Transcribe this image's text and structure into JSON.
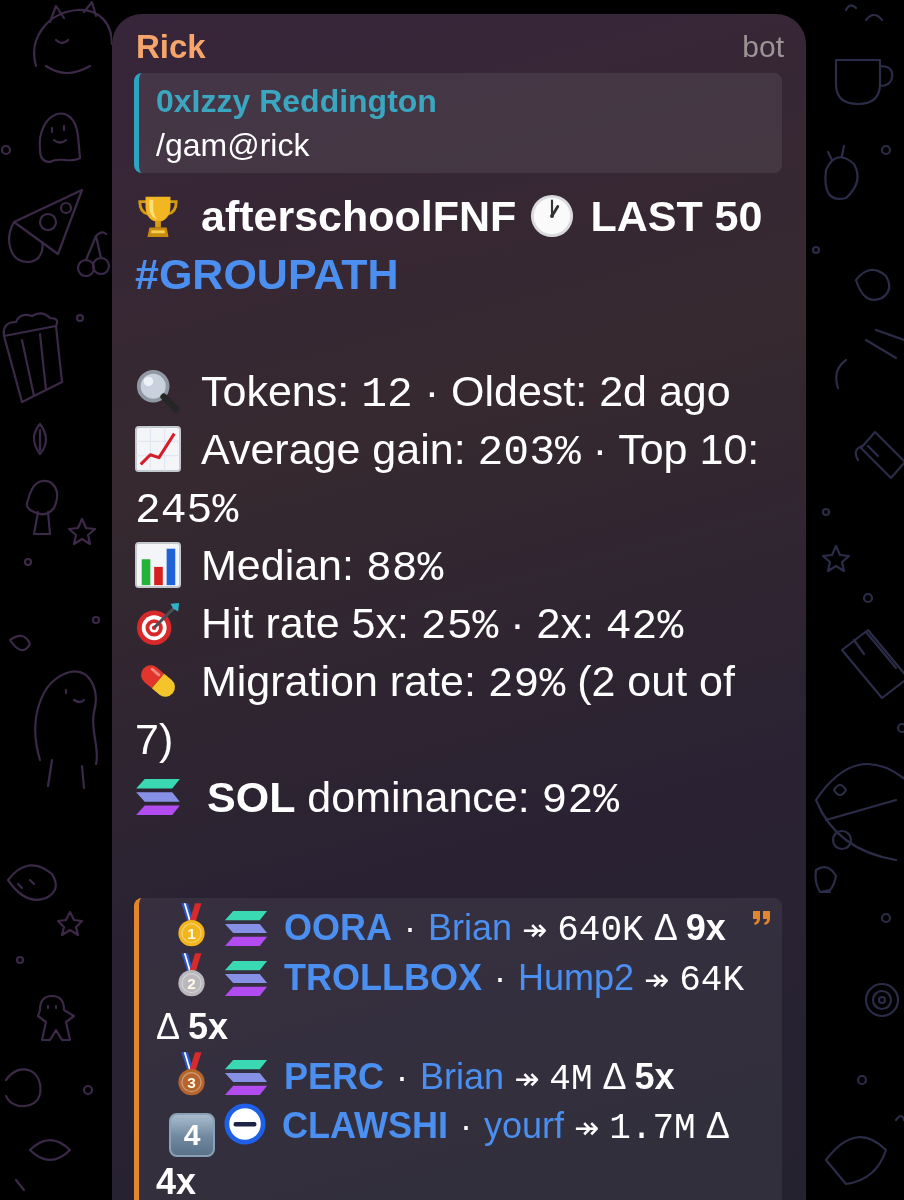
{
  "header": {
    "sender": "Rick",
    "badge": "bot"
  },
  "reply": {
    "author": "0xIzzy Reddington",
    "text": "/gam@rick"
  },
  "title": {
    "group": "afterschoolFNF",
    "period": "LAST 50",
    "hashtag": "#GROUPATH"
  },
  "stats": [
    {
      "segments": [
        {
          "kind": "text",
          "text": "Tokens: "
        },
        {
          "kind": "code",
          "text": "12"
        },
        {
          "kind": "text",
          "text": " · Oldest: 2d ago"
        }
      ]
    },
    {
      "segments": [
        {
          "kind": "text",
          "text": "Average gain: "
        },
        {
          "kind": "code",
          "text": "203%"
        },
        {
          "kind": "text",
          "text": " · Top 10: "
        },
        {
          "kind": "code",
          "text": "245%"
        }
      ]
    },
    {
      "segments": [
        {
          "kind": "text",
          "text": "Median: "
        },
        {
          "kind": "code",
          "text": "88%"
        }
      ]
    },
    {
      "segments": [
        {
          "kind": "text",
          "text": "Hit rate 5x: "
        },
        {
          "kind": "code",
          "text": "25%"
        },
        {
          "kind": "text",
          "text": " · 2x: "
        },
        {
          "kind": "code",
          "text": "42%"
        }
      ]
    },
    {
      "segments": [
        {
          "kind": "text",
          "text": "Migration rate: "
        },
        {
          "kind": "code",
          "text": "29%"
        },
        {
          "kind": "text",
          "text": " (2 out of 7)"
        }
      ]
    },
    {
      "segments": [
        {
          "kind": "bold",
          "text": "SOL"
        },
        {
          "kind": "text",
          "text": " dominance: "
        },
        {
          "kind": "code",
          "text": "92%"
        }
      ]
    }
  ],
  "leaderboard": [
    {
      "rank": {
        "kind": "medal",
        "text": "1",
        "color": "#f2b51c"
      },
      "chain": {
        "kind": "stripes"
      },
      "token": "OORA",
      "sep": "·",
      "caller": "Brian",
      "arrow": "↠",
      "mcap": "640K",
      "delta": "Δ",
      "multiple": "9x"
    },
    {
      "rank": {
        "kind": "medal",
        "text": "2",
        "color": "#b9b9bd"
      },
      "chain": {
        "kind": "stripes"
      },
      "token": "TROLLBOX",
      "sep": "·",
      "caller": "Hump2",
      "arrow": "↠",
      "mcap": "64K",
      "delta": "Δ",
      "multiple": "5x"
    },
    {
      "rank": {
        "kind": "medal",
        "text": "3",
        "color": "#b5652c"
      },
      "chain": {
        "kind": "stripes"
      },
      "token": "PERC",
      "sep": "·",
      "caller": "Brian",
      "arrow": "↠",
      "mcap": "4M",
      "delta": "Δ",
      "multiple": "5x"
    },
    {
      "rank": {
        "kind": "keycap",
        "text": "4"
      },
      "chain": {
        "kind": "ring"
      },
      "token": "CLAWSHI",
      "sep": "·",
      "caller": "yourf",
      "arrow": "↠",
      "mcap": "1.7M",
      "delta": "Δ",
      "multiple": "4x"
    }
  ]
}
